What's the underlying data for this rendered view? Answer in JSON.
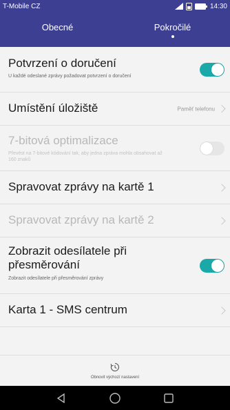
{
  "status": {
    "carrier": "T-Mobile CZ",
    "time": "14:30"
  },
  "tabs": [
    {
      "label": "Obecné",
      "active": false
    },
    {
      "label": "Pokročilé",
      "active": true
    }
  ],
  "rows": [
    {
      "title": "Potvrzení o doručení",
      "sub": "U každé odeslané zprávy požadovat potvrzení o doručení",
      "toggle": "on"
    },
    {
      "title": "Umístění úložiště",
      "value": "Paměť telefonu"
    },
    {
      "title": "7-bitová optimalizace",
      "sub": "Převést na 7-bitové kódování tak, aby jedna zpráva mohla obsahovat až 160 znaků",
      "toggle": "off",
      "disabled": true
    },
    {
      "title": "Spravovat zprávy na kartě 1"
    },
    {
      "title": "Spravovat zprávy na kartě 2",
      "disabled": true
    },
    {
      "title": "Zobrazit odesílatele při přesměrování",
      "sub": "Zobrazit odesílatele při přesměrování zprávy",
      "toggle": "on"
    },
    {
      "title": "Karta 1 - SMS centrum"
    }
  ],
  "bottom": {
    "label": "Obnovit výchozí nastavení"
  },
  "colors": {
    "header": "#3c3f92",
    "accent": "#1aa8a8"
  },
  "icons": {
    "back": "back-icon",
    "home": "home-icon",
    "recent": "recent-apps-icon",
    "restore": "restore-icon"
  }
}
